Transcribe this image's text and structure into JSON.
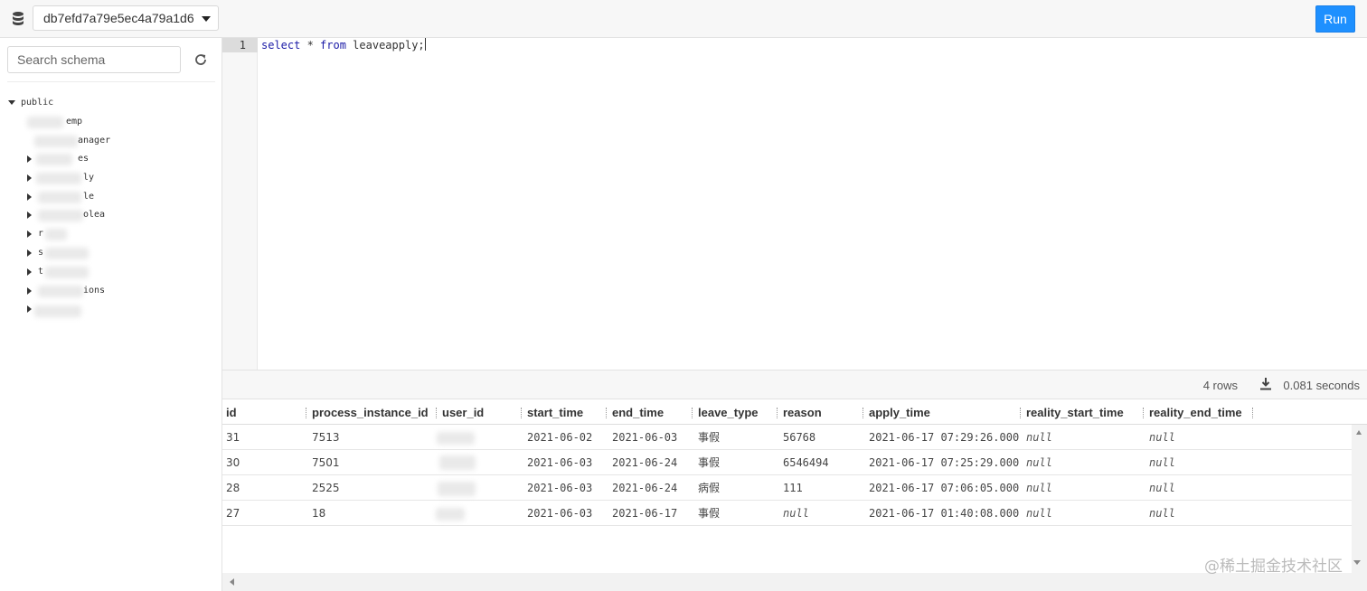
{
  "toolbar": {
    "database": "db7efd7a79e5ec4a79a1d6",
    "run_label": "Run"
  },
  "sidebar": {
    "search_placeholder": "Search schema",
    "schema": "public",
    "tables": [
      {
        "label": "emp",
        "expanded": false,
        "has_toggle": false
      },
      {
        "label": "anager",
        "expanded": false,
        "has_toggle": false
      },
      {
        "label": "es",
        "expanded": false,
        "has_toggle": true
      },
      {
        "label": "ly",
        "expanded": false,
        "has_toggle": true
      },
      {
        "label": "le",
        "expanded": false,
        "has_toggle": true
      },
      {
        "label": "olea",
        "expanded": false,
        "has_toggle": true
      },
      {
        "label": "r",
        "expanded": false,
        "has_toggle": true
      },
      {
        "label": "s",
        "expanded": false,
        "has_toggle": true
      },
      {
        "label": "t",
        "expanded": false,
        "has_toggle": true
      },
      {
        "label": "ions",
        "expanded": false,
        "has_toggle": true
      },
      {
        "label": "",
        "expanded": false,
        "has_toggle": true
      }
    ]
  },
  "editor": {
    "line_number": "1",
    "kw_select": "select",
    "code_star": " * ",
    "kw_from": "from",
    "code_rest": " leaveapply;"
  },
  "results": {
    "rows_label": "4 rows",
    "elapsed": "0.081 seconds",
    "columns": [
      "id",
      "process_instance_id",
      "user_id",
      "start_time",
      "end_time",
      "leave_type",
      "reason",
      "apply_time",
      "reality_start_time",
      "reality_end_time"
    ],
    "rows": [
      {
        "id": "31",
        "process_instance_id": "7513",
        "user_id": "",
        "start_time": "2021-06-02",
        "end_time": "2021-06-03",
        "leave_type": "事假",
        "reason": "56768",
        "apply_time": "2021-06-17 07:29:26.000",
        "reality_start_time": "null",
        "reality_end_time": "null"
      },
      {
        "id": "30",
        "process_instance_id": "7501",
        "user_id": "",
        "start_time": "2021-06-03",
        "end_time": "2021-06-24",
        "leave_type": "事假",
        "reason": "6546494",
        "apply_time": "2021-06-17 07:25:29.000",
        "reality_start_time": "null",
        "reality_end_time": "null"
      },
      {
        "id": "28",
        "process_instance_id": "2525",
        "user_id": "",
        "start_time": "2021-06-03",
        "end_time": "2021-06-24",
        "leave_type": "病假",
        "reason": "111",
        "apply_time": "2021-06-17 07:06:05.000",
        "reality_start_time": "null",
        "reality_end_time": "null"
      },
      {
        "id": "27",
        "process_instance_id": "18",
        "user_id": "",
        "start_time": "2021-06-03",
        "end_time": "2021-06-17",
        "leave_type": "事假",
        "reason": "null",
        "apply_time": "2021-06-17 01:40:08.000",
        "reality_start_time": "null",
        "reality_end_time": "null"
      }
    ]
  },
  "watermark": "@稀土掘金技术社区",
  "icons": {
    "database": "database-icon",
    "refresh": "refresh-icon",
    "download": "download-icon",
    "caret": "chevron-down-icon"
  },
  "colors": {
    "run_button": "#1e90ff",
    "keyword": "#1a1aa6"
  }
}
